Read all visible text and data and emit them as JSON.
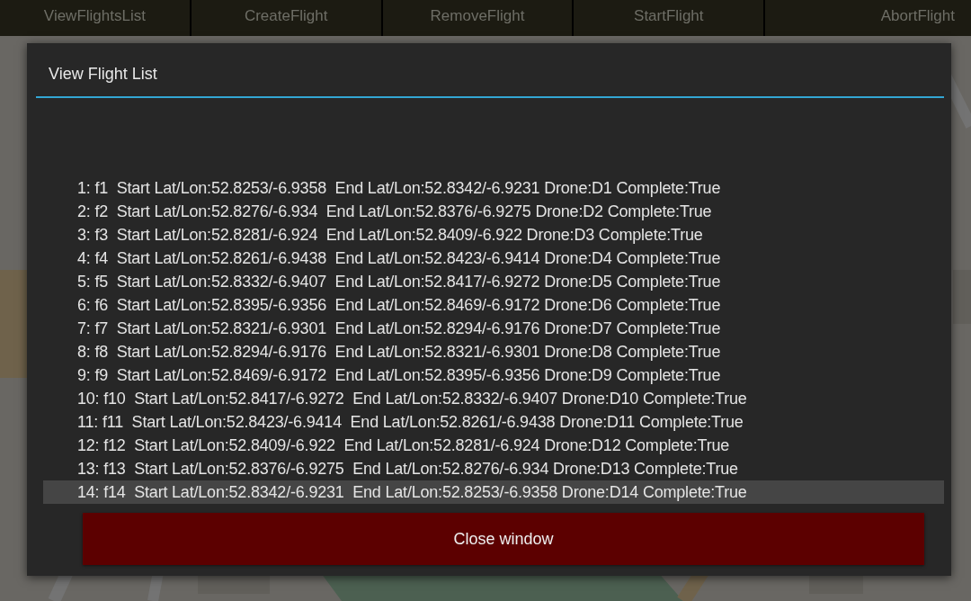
{
  "toolbar": {
    "buttons": [
      "ViewFlightsList",
      "CreateFlight",
      "RemoveFlight",
      "StartFlight",
      "AbortFlight"
    ]
  },
  "dialog": {
    "title": "View Flight List",
    "rows": [
      {
        "text": "1: f1  Start Lat/Lon:52.8253/-6.9358  End Lat/Lon:52.8342/-6.9231 Drone:D1 Complete:True",
        "selected": false
      },
      {
        "text": "2: f2  Start Lat/Lon:52.8276/-6.934  End Lat/Lon:52.8376/-6.9275 Drone:D2 Complete:True",
        "selected": false
      },
      {
        "text": "3: f3  Start Lat/Lon:52.8281/-6.924  End Lat/Lon:52.8409/-6.922 Drone:D3 Complete:True",
        "selected": false
      },
      {
        "text": "4: f4  Start Lat/Lon:52.8261/-6.9438  End Lat/Lon:52.8423/-6.9414 Drone:D4 Complete:True",
        "selected": false
      },
      {
        "text": "5: f5  Start Lat/Lon:52.8332/-6.9407  End Lat/Lon:52.8417/-6.9272 Drone:D5 Complete:True",
        "selected": false
      },
      {
        "text": "6: f6  Start Lat/Lon:52.8395/-6.9356  End Lat/Lon:52.8469/-6.9172 Drone:D6 Complete:True",
        "selected": false
      },
      {
        "text": "7: f7  Start Lat/Lon:52.8321/-6.9301  End Lat/Lon:52.8294/-6.9176 Drone:D7 Complete:True",
        "selected": false
      },
      {
        "text": "8: f8  Start Lat/Lon:52.8294/-6.9176  End Lat/Lon:52.8321/-6.9301 Drone:D8 Complete:True",
        "selected": false
      },
      {
        "text": "9: f9  Start Lat/Lon:52.8469/-6.9172  End Lat/Lon:52.8395/-6.9356 Drone:D9 Complete:True",
        "selected": false
      },
      {
        "text": "10: f10  Start Lat/Lon:52.8417/-6.9272  End Lat/Lon:52.8332/-6.9407 Drone:D10 Complete:True",
        "selected": false
      },
      {
        "text": "11: f11  Start Lat/Lon:52.8423/-6.9414  End Lat/Lon:52.8261/-6.9438 Drone:D11 Complete:True",
        "selected": false
      },
      {
        "text": "12: f12  Start Lat/Lon:52.8409/-6.922  End Lat/Lon:52.8281/-6.924 Drone:D12 Complete:True",
        "selected": false
      },
      {
        "text": "13: f13  Start Lat/Lon:52.8376/-6.9275  End Lat/Lon:52.8276/-6.934 Drone:D13 Complete:True",
        "selected": false
      },
      {
        "text": "14: f14  Start Lat/Lon:52.8342/-6.9231  End Lat/Lon:52.8253/-6.9358 Drone:D14 Complete:True",
        "selected": true
      }
    ],
    "close_button": "Close window"
  }
}
